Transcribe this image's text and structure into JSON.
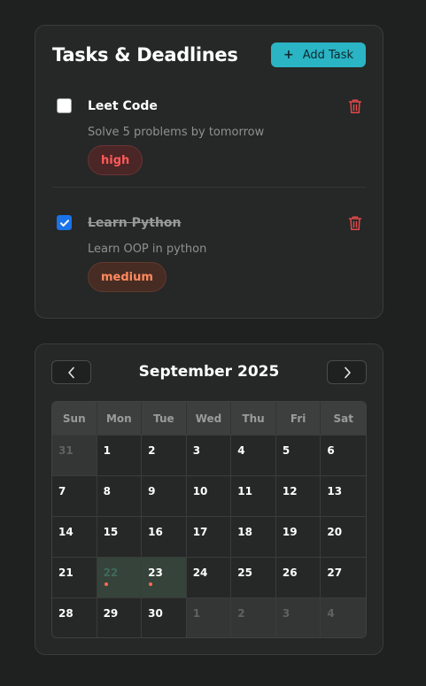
{
  "tasks_panel": {
    "title": "Tasks & Deadlines",
    "add_button_label": "Add Task",
    "add_button_icon": "+",
    "tasks": [
      {
        "title": "Leet Code",
        "description": "Solve 5 problems by tomorrow",
        "priority": "high",
        "completed": false
      },
      {
        "title": "Learn Python",
        "description": "Learn OOP in python",
        "priority": "medium",
        "completed": true
      }
    ]
  },
  "calendar": {
    "month_title": "September 2025",
    "weekdays": [
      "Sun",
      "Mon",
      "Tue",
      "Wed",
      "Thu",
      "Fri",
      "Sat"
    ],
    "days": [
      {
        "label": "31",
        "outside": true
      },
      {
        "label": "1"
      },
      {
        "label": "2"
      },
      {
        "label": "3"
      },
      {
        "label": "4"
      },
      {
        "label": "5"
      },
      {
        "label": "6"
      },
      {
        "label": "7"
      },
      {
        "label": "8"
      },
      {
        "label": "9"
      },
      {
        "label": "10"
      },
      {
        "label": "11"
      },
      {
        "label": "12"
      },
      {
        "label": "13"
      },
      {
        "label": "14"
      },
      {
        "label": "15"
      },
      {
        "label": "16"
      },
      {
        "label": "17"
      },
      {
        "label": "18"
      },
      {
        "label": "19"
      },
      {
        "label": "20"
      },
      {
        "label": "21"
      },
      {
        "label": "22",
        "today": true,
        "has_task": true
      },
      {
        "label": "23",
        "has_task": true
      },
      {
        "label": "24"
      },
      {
        "label": "25"
      },
      {
        "label": "26"
      },
      {
        "label": "27"
      },
      {
        "label": "28"
      },
      {
        "label": "29"
      },
      {
        "label": "30"
      },
      {
        "label": "1",
        "outside": true
      },
      {
        "label": "2",
        "outside": true
      },
      {
        "label": "3",
        "outside": true
      },
      {
        "label": "4",
        "outside": true
      }
    ]
  },
  "icons": {
    "delete": "trash-icon",
    "prev": "chevron-left-icon",
    "next": "chevron-right-icon",
    "check": "check-icon"
  },
  "colors": {
    "accent": "#2ab4c4",
    "high_priority": "#ff5a5a",
    "medium_priority": "#ff8a5e",
    "delete": "#e04848",
    "task_dot": "#ff6a50",
    "checkbox_checked": "#1a73e8"
  }
}
